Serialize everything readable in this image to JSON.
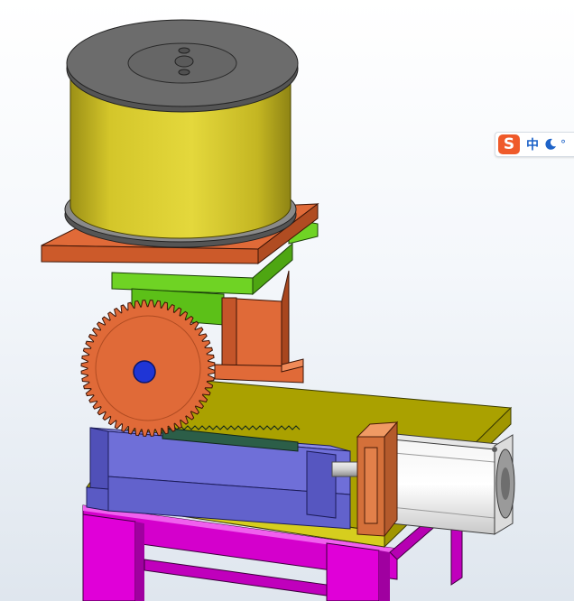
{
  "window": {
    "background": "#f4f7fb"
  },
  "viewport": {
    "name": "3D model view",
    "parts": [
      {
        "id": "spool",
        "color": "#d4c62a",
        "icon": "spool"
      },
      {
        "id": "upper-plate",
        "color": "#e06a38"
      },
      {
        "id": "green-bracket",
        "color": "#6fd324"
      },
      {
        "id": "orange-column",
        "color": "#e06a38"
      },
      {
        "id": "gear",
        "color": "#e06a38",
        "hub_color": "#1f35d6"
      },
      {
        "id": "base-plate",
        "color": "#d6ce1e"
      },
      {
        "id": "blue-slide",
        "color": "#6f6fd8"
      },
      {
        "id": "rack",
        "color": "#2c5e48"
      },
      {
        "id": "air-cylinder",
        "color": "#ffffff"
      },
      {
        "id": "cylinder-mount",
        "color": "#e2804a"
      },
      {
        "id": "frame",
        "color": "#e000d8"
      }
    ]
  },
  "ime": {
    "logo": "S",
    "mode": "中",
    "punct": "°",
    "icons": [
      "sogou-logo-icon",
      "moon-icon"
    ]
  }
}
